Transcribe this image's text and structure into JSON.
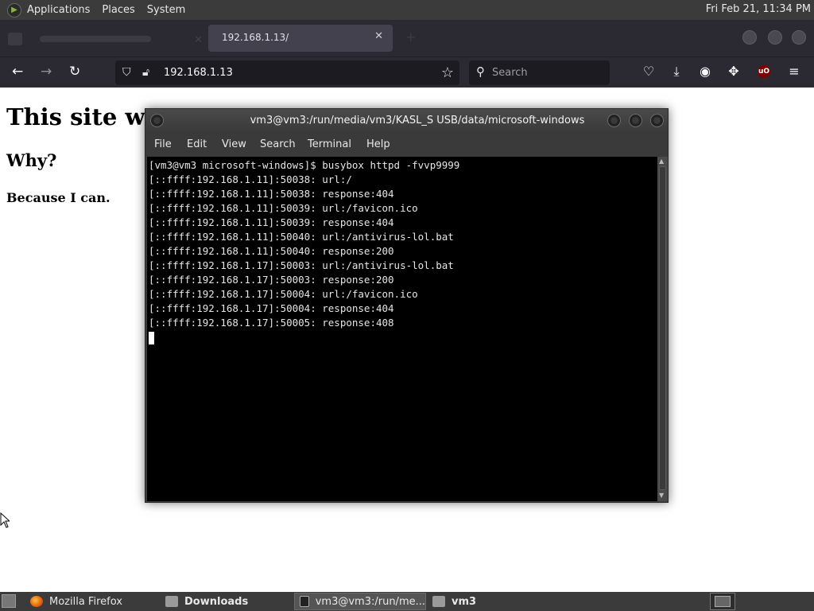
{
  "top_panel": {
    "menus": [
      "Applications",
      "Places",
      "System"
    ],
    "clock": "Fri Feb 21, 11:34 PM"
  },
  "browser": {
    "tab_title": "192.168.1.13/",
    "url": "192.168.1.13",
    "search_placeholder": "Search",
    "ublock_label": "uO"
  },
  "page": {
    "heading": "This site was",
    "subheading": "Why?",
    "text": "Because I can."
  },
  "terminal": {
    "title": "vm3@vm3:/run/media/vm3/KASL_S USB/data/microsoft-windows",
    "menu": [
      "File",
      "Edit",
      "View",
      "Search",
      "Terminal",
      "Help"
    ],
    "lines": [
      "[vm3@vm3 microsoft-windows]$ busybox httpd -fvvp9999",
      "[::ffff:192.168.1.11]:50038: url:/",
      "[::ffff:192.168.1.11]:50038: response:404",
      "[::ffff:192.168.1.11]:50039: url:/favicon.ico",
      "[::ffff:192.168.1.11]:50039: response:404",
      "[::ffff:192.168.1.11]:50040: url:/antivirus-lol.bat",
      "[::ffff:192.168.1.11]:50040: response:200",
      "[::ffff:192.168.1.17]:50003: url:/antivirus-lol.bat",
      "[::ffff:192.168.1.17]:50003: response:200",
      "[::ffff:192.168.1.17]:50004: url:/favicon.ico",
      "[::ffff:192.168.1.17]:50004: response:404",
      "[::ffff:192.168.1.17]:50005: response:408"
    ]
  },
  "taskbar": {
    "items": [
      {
        "label": "Mozilla Firefox",
        "icon": "firefox-icon"
      },
      {
        "label": "Downloads",
        "icon": "folder-icon"
      },
      {
        "label": "vm3@vm3:/run/me...",
        "icon": "terminal-icon"
      },
      {
        "label": "vm3",
        "icon": "folder-icon"
      }
    ]
  }
}
